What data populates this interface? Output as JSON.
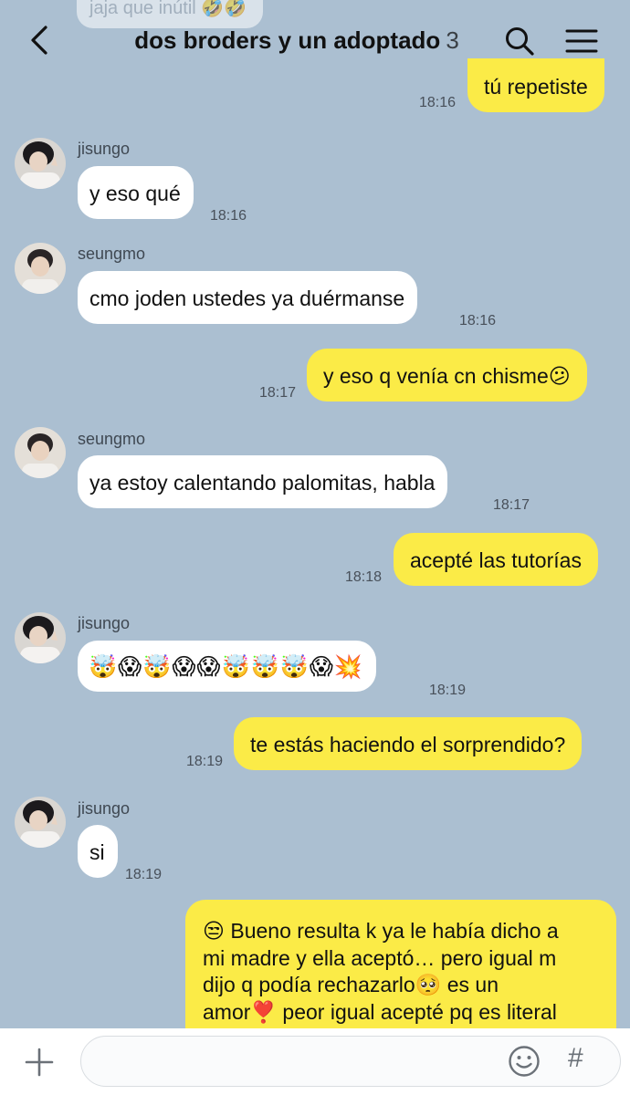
{
  "header": {
    "title": "dos broders y un adoptado",
    "member_count": "3",
    "icons": [
      "back-icon",
      "search-icon",
      "menu-icon"
    ]
  },
  "top_partial": "jaja que inútil 🤣🤣",
  "messages": [
    {
      "type": "out",
      "text": "tú repetiste",
      "time": "18:16"
    },
    {
      "type": "in",
      "sender": "jisungo",
      "text": "y eso qué",
      "time": "18:16"
    },
    {
      "type": "in",
      "sender": "seungmo",
      "text": "cmo joden ustedes ya duérmanse",
      "time": "18:16"
    },
    {
      "type": "out",
      "text": "y eso q venía cn chisme😕",
      "time": "18:17"
    },
    {
      "type": "in",
      "sender": "seungmo",
      "text": "ya estoy calentando palomitas, habla",
      "time": "18:17"
    },
    {
      "type": "out",
      "text": "acepté las tutorías",
      "time": "18:18"
    },
    {
      "type": "in",
      "sender": "jisungo",
      "text": "🤯😱🤯😱😱🤯🤯🤯😱💥",
      "time": "18:19"
    },
    {
      "type": "out",
      "text": "te estás haciendo el sorprendido?",
      "time": "18:19"
    },
    {
      "type": "in",
      "sender": "jisungo",
      "text": "si",
      "time": "18:19"
    },
    {
      "type": "out",
      "lines": [
        "😒 Bueno resulta k ya le había dicho a",
        "mi madre y ella aceptó… pero igual m",
        "dijo q podía rechazarlo🥺 es un",
        "amor❣️ peor igual acepté pq es literal"
      ]
    }
  ],
  "input": {
    "placeholder": "",
    "icons": [
      "plus-icon",
      "smile-icon",
      "hash-icon"
    ],
    "hash_label": "#"
  },
  "colors": {
    "background": "#abbfd1",
    "incoming_bubble": "#ffffff",
    "outgoing_bubble": "#fbeb47"
  }
}
